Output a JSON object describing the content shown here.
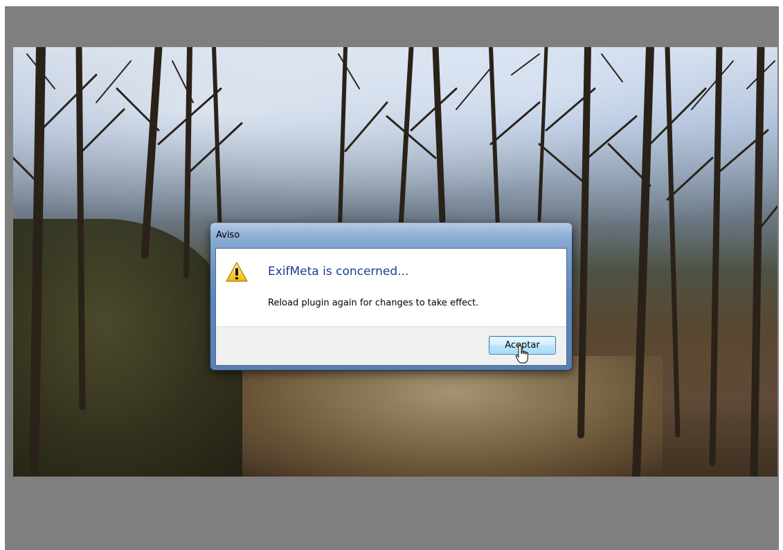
{
  "dialog": {
    "title": "Aviso",
    "heading": "ExifMeta is concerned...",
    "message": "Reload plugin again for changes to take effect.",
    "ok_label": "Aceptar",
    "icon": "warning-icon",
    "heading_color": "#1a3d8f"
  },
  "background": {
    "frame_color": "#7f7f7f"
  }
}
